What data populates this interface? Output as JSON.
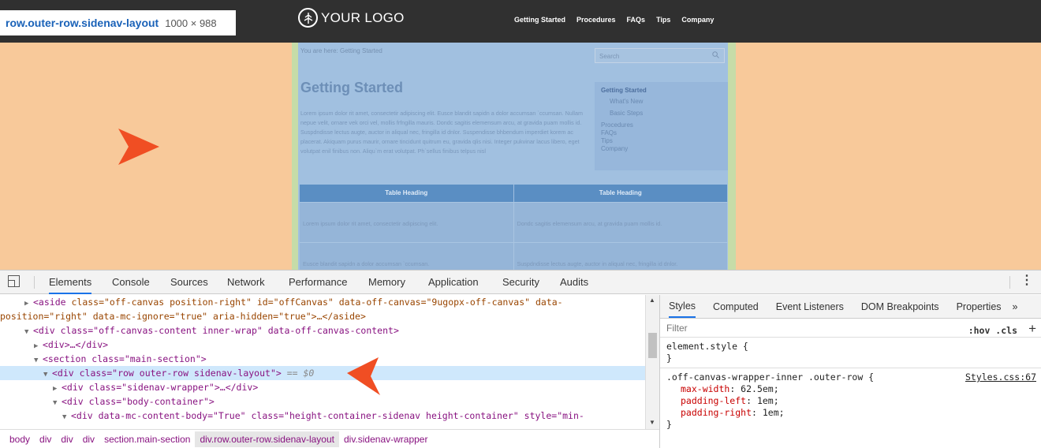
{
  "inspect_tooltip": {
    "element": "row.outer-row.sidenav-layout",
    "size": "1000 × 988"
  },
  "site": {
    "logo_text": "YOUR LOGO",
    "menu": [
      "Getting Started",
      "Procedures",
      "FAQs",
      "Tips",
      "Company"
    ],
    "breadcrumb": "You are here: Getting Started",
    "search_placeholder": "Search",
    "title": "Getting Started",
    "body": "Lorem ipsum dolor rit amet, consectetir adipiscing elit. Eusce blandit sapidn a dolor accumsan `ccumsan. Nullam nepue velit, ornare vek orci vel, mollis frfngilla mauris. Dondc sagitis elemensum arcu, at gravida puam mollis id. Suspdndisse lectus augte, auctor in aliqual nec, fringilla id dnlor. Suspendisse bhbendum imperdiet korem ac placerat. Akiquam purus maurir, ornare tincidunt quitrum eu, gravida qlis nisi. Integer pukvinar lacus libero, eget volutpat enil finibus non. Aliqu`m erat volutpat. Ph`sellus finibus telpus nisl",
    "sidenav": {
      "current": "Getting Started",
      "sub": [
        "What's New",
        "Basic Steps"
      ],
      "items": [
        "Procedures",
        "FAQs",
        "Tips",
        "Company"
      ]
    },
    "table": {
      "headings": [
        "Table Heading",
        "Table Heading"
      ],
      "rows": [
        [
          "Lorem ipsum dolor rit amet, consectetir adipiscing elit.",
          "Dondc sagitis elemensum arcu, at gravida puam mollis id."
        ],
        [
          "Eusce blandit sapidn a dolor accumsan `ccumsan.",
          "Suspdndisse lectus augte, auctor in aliqual nec, fringilla id dnlor."
        ]
      ]
    }
  },
  "devtools": {
    "tabs": [
      "Elements",
      "Console",
      "Sources",
      "Network",
      "Performance",
      "Memory",
      "Application",
      "Security",
      "Audits"
    ],
    "active_tab": "Elements",
    "dom": {
      "l1_tag": "<aside",
      "l1_attrs": " class=\"off-canvas position-right\" id=\"offCanvas\" data-off-canvas=\"9ugopx-off-canvas\" data-",
      "l2": "position=\"right\" data-mc-ignore=\"true\" aria-hidden=\"true\">…</aside>",
      "l3": "<div class=\"off-canvas-content inner-wrap\" data-off-canvas-content>",
      "l4": "<div>…</div>",
      "l5": "<section class=\"main-section\">",
      "l6": "<div class=\"row outer-row sidenav-layout\">",
      "l6_eq": "== $0",
      "l7": "<div class=\"sidenav-wrapper\">…</div>",
      "l8": "<div class=\"body-container\">",
      "l9": "<div data-mc-content-body=\"True\" class=\"height-container-sidenav height-container\" style=\"min-"
    },
    "breadcrumbs": [
      "body",
      "div",
      "div",
      "div",
      "section.main-section",
      "div.row.outer-row.sidenav-layout",
      "div.sidenav-wrapper"
    ],
    "styles": {
      "tabs": [
        "Styles",
        "Computed",
        "Event Listeners",
        "DOM Breakpoints",
        "Properties",
        "»"
      ],
      "filter_placeholder": "Filter",
      "hov_cls": ":hov .cls",
      "plus": "+",
      "element_style": "element.style {",
      "close_brace": "}",
      "rule_selector": ".off-canvas-wrapper-inner .outer-row {",
      "rule_source": "Styles.css:67",
      "props": [
        {
          "name": "max-width",
          "value": "62.5em;"
        },
        {
          "name": "padding-left",
          "value": "1em;"
        },
        {
          "name": "padding-right",
          "value": "1em;"
        }
      ]
    }
  },
  "accent_colors": {
    "highlight_margin": "#f8c99a",
    "highlight_content": "#a1c0e0",
    "highlight_padding": "#c6dca8",
    "callout_arrow": "#f04e23"
  }
}
